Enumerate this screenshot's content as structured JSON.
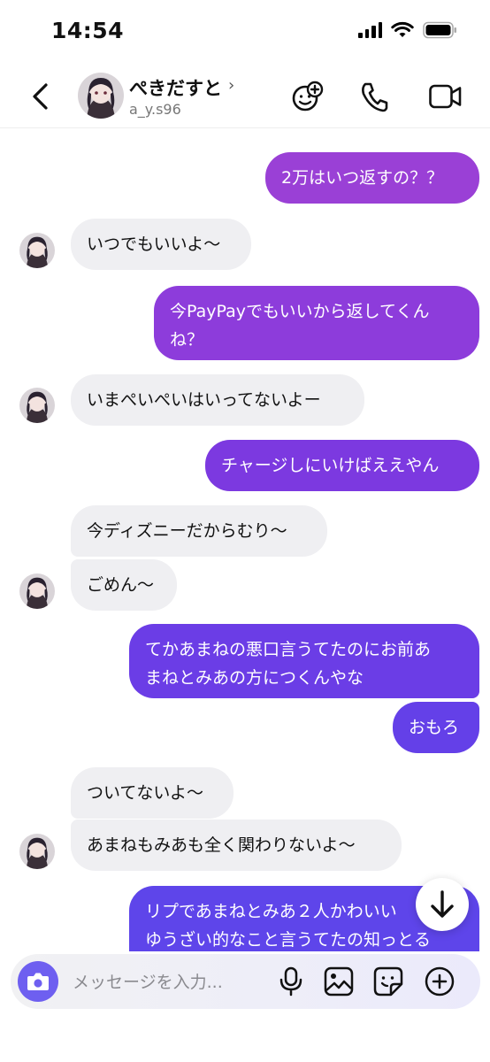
{
  "status_bar": {
    "time": "14:54"
  },
  "header": {
    "contact_name": "ぺきだすと",
    "contact_handle": "a_y.s96"
  },
  "messages": [
    {
      "from": "me",
      "text": "2万はいつ返すの？？"
    },
    {
      "from": "them",
      "text": "いつでもいいよ〜"
    },
    {
      "from": "me",
      "text": "今PayPayでもいいから返してくん\nね？"
    },
    {
      "from": "them",
      "text": "いまぺいぺいはいってないよー"
    },
    {
      "from": "me",
      "text": "チャージしにいけばええやん"
    },
    {
      "from": "them",
      "text": "今ディズニーだからむり〜"
    },
    {
      "from": "them",
      "text": "ごめん〜"
    },
    {
      "from": "me",
      "text": "てかあまねの悪口言うてたのにお前あ\nまねとみあの方につくんやな"
    },
    {
      "from": "me",
      "text": "おもろ"
    },
    {
      "from": "them",
      "text": "ついてないよ〜"
    },
    {
      "from": "them",
      "text": "あまねもみあも全く関わりないよ〜"
    },
    {
      "from": "me",
      "text": "リプであまねとみあ２人かわいい\nゆうざい的なこと言うてたの知っとる"
    }
  ],
  "composer": {
    "placeholder": "メッセージを入力..."
  },
  "colors": {
    "accent": "#6e5ff0",
    "bubble_in": "#efeff2",
    "bubble_out_top": "#9b3fd6",
    "bubble_out_bottom": "#5b4ef0"
  }
}
